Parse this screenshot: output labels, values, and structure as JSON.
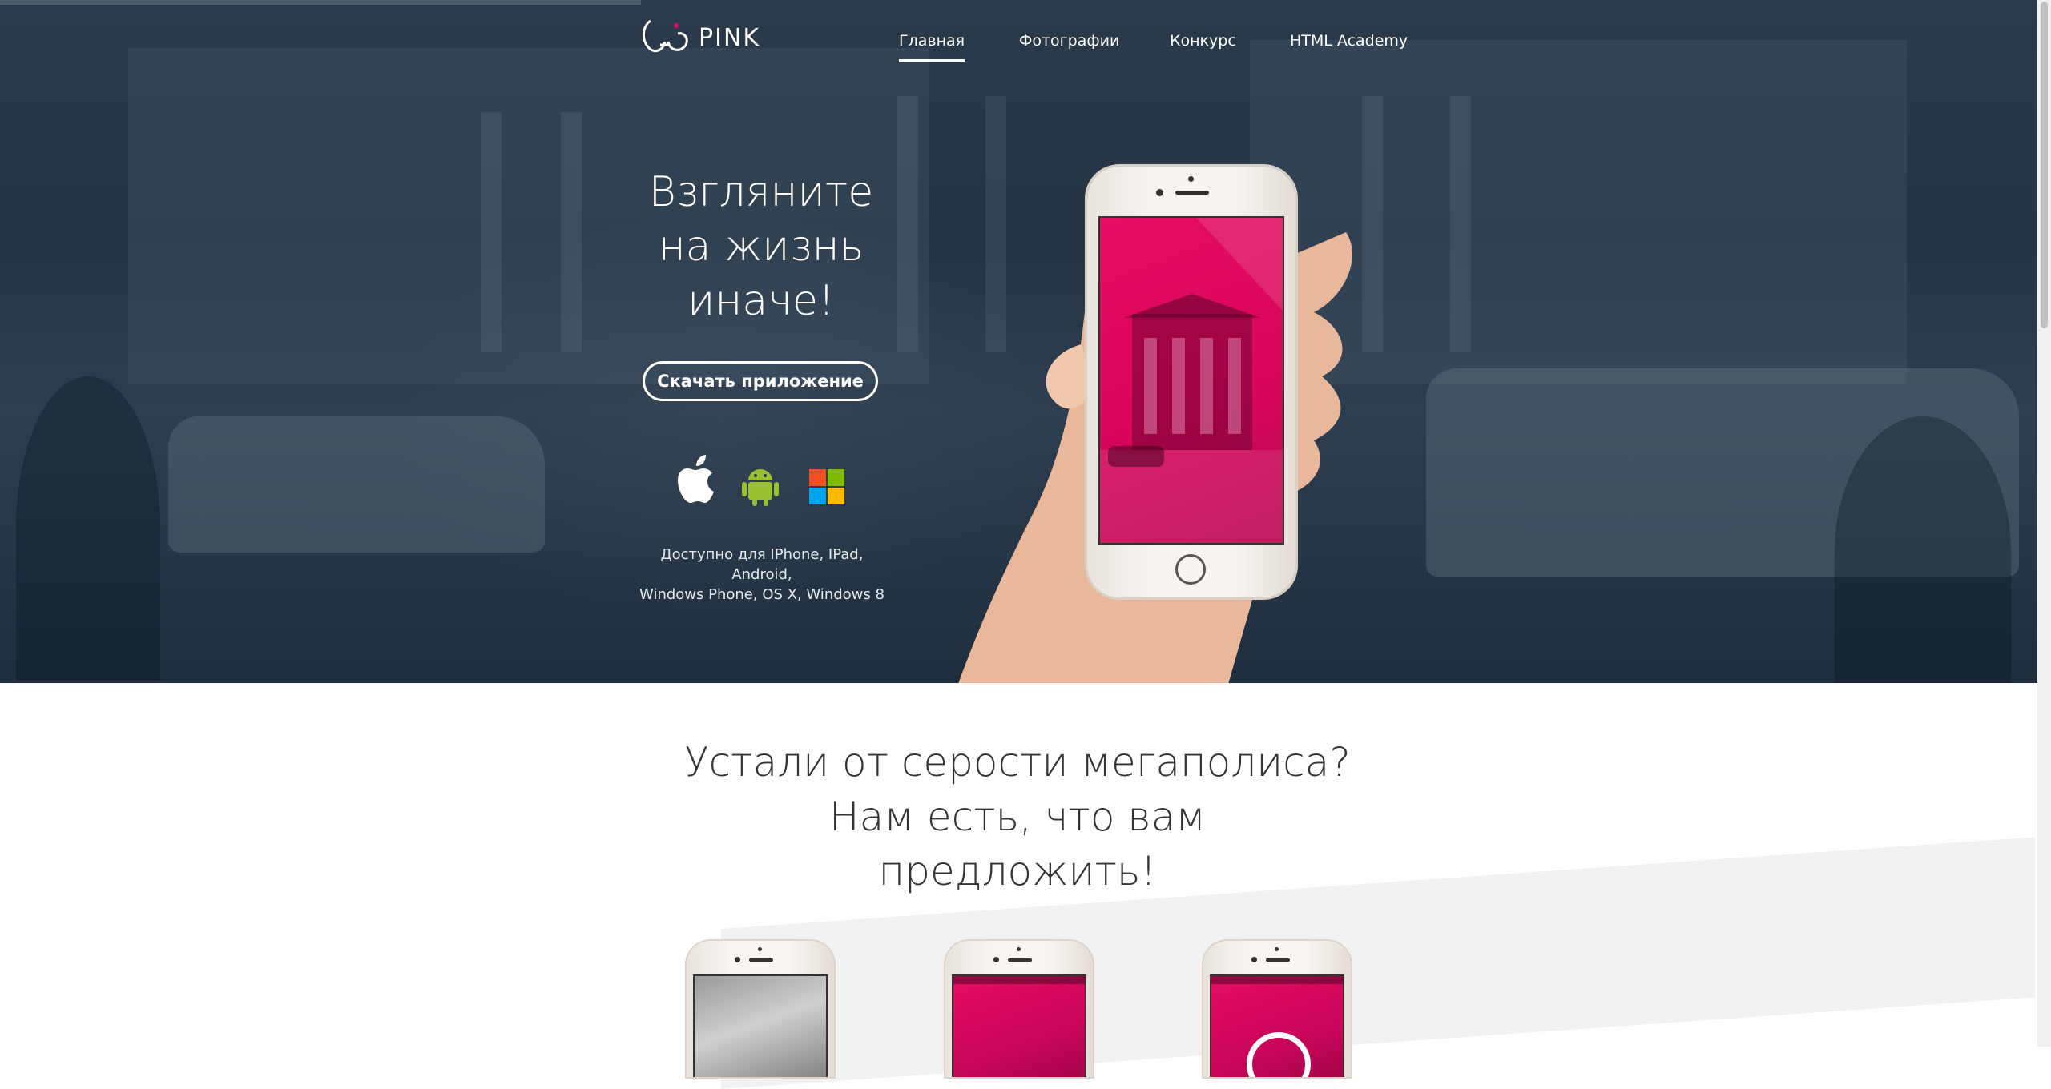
{
  "brand": {
    "name": "PINK"
  },
  "nav": {
    "items": [
      {
        "label": "Главная",
        "active": true
      },
      {
        "label": "Фотографии",
        "active": false
      },
      {
        "label": "Конкурс",
        "active": false
      },
      {
        "label": "HTML Academy",
        "active": false
      }
    ]
  },
  "hero": {
    "title_lines": [
      "Взгляните",
      "на жизнь",
      "иначе!"
    ],
    "download_label": "Скачать приложение",
    "platforms": [
      "apple-icon",
      "android-icon",
      "windows-icon"
    ],
    "availability_lines": [
      "Доступно для IPhone, IPad, Android,",
      "Windows Phone, OS X, Windows 8"
    ]
  },
  "section2": {
    "title_lines": [
      "Устали от серости мегаполиса?",
      "Нам есть, что вам",
      "предложить!"
    ]
  },
  "colors": {
    "accent": "#e50d60",
    "hero_bg": "#263646",
    "text_dark": "#333333"
  }
}
